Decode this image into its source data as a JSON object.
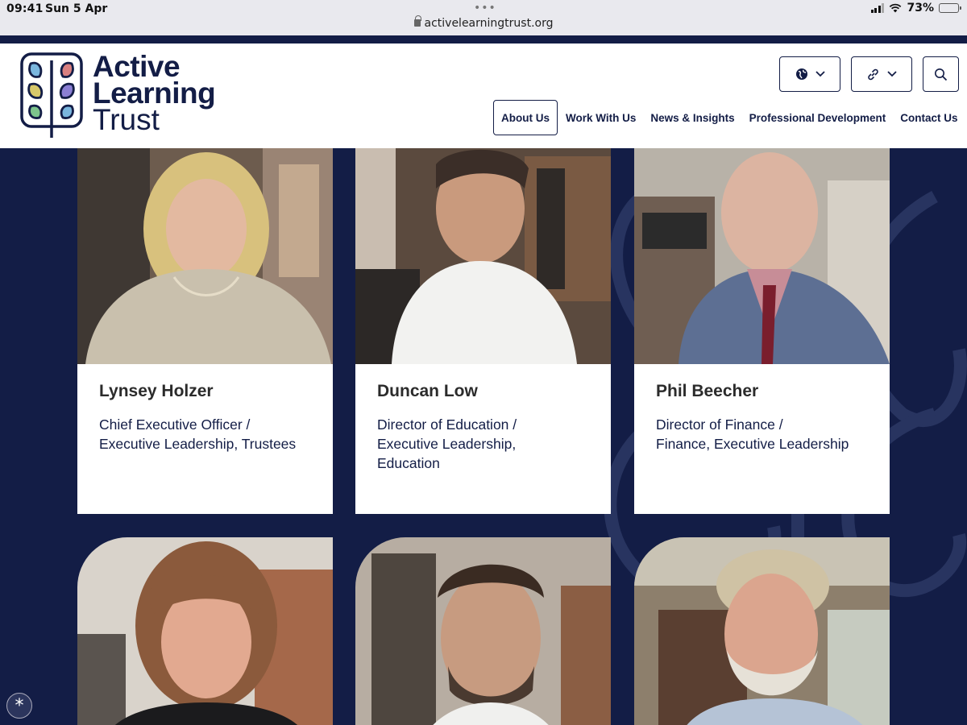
{
  "status_bar": {
    "time": "09:41",
    "date": "Sun 5 Apr",
    "url": "activelearningtrust.org",
    "battery": "73%",
    "battery_level": 0.73
  },
  "header": {
    "logo_lines": [
      "Active",
      "Learning",
      "Trust"
    ],
    "lang_icon": "globe-icon",
    "links_icon": "link-icon",
    "search_icon": "search-icon",
    "nav": [
      "About Us",
      "Work With Us",
      "News & Insights",
      "Professional Development",
      "Contact Us"
    ],
    "active_nav": "About Us"
  },
  "people": [
    {
      "name": "Lynsey Holzer",
      "role_lines": [
        "Chief Executive Officer /",
        "Executive Leadership, Trustees"
      ]
    },
    {
      "name": "Duncan Low",
      "role_lines": [
        "Director of Education /",
        "Executive Leadership,",
        "Education"
      ]
    },
    {
      "name": "Phil Beecher",
      "role_lines": [
        "Director of Finance /",
        "Finance, Executive Leadership"
      ]
    }
  ],
  "colors": {
    "navy": "#131d46",
    "leaf_purple": "#8b7fd4",
    "leaf_green": "#7dc48c",
    "leaf_yellow": "#d7c86a",
    "leaf_red": "#d98080",
    "leaf_blue": "#7ab6de"
  }
}
